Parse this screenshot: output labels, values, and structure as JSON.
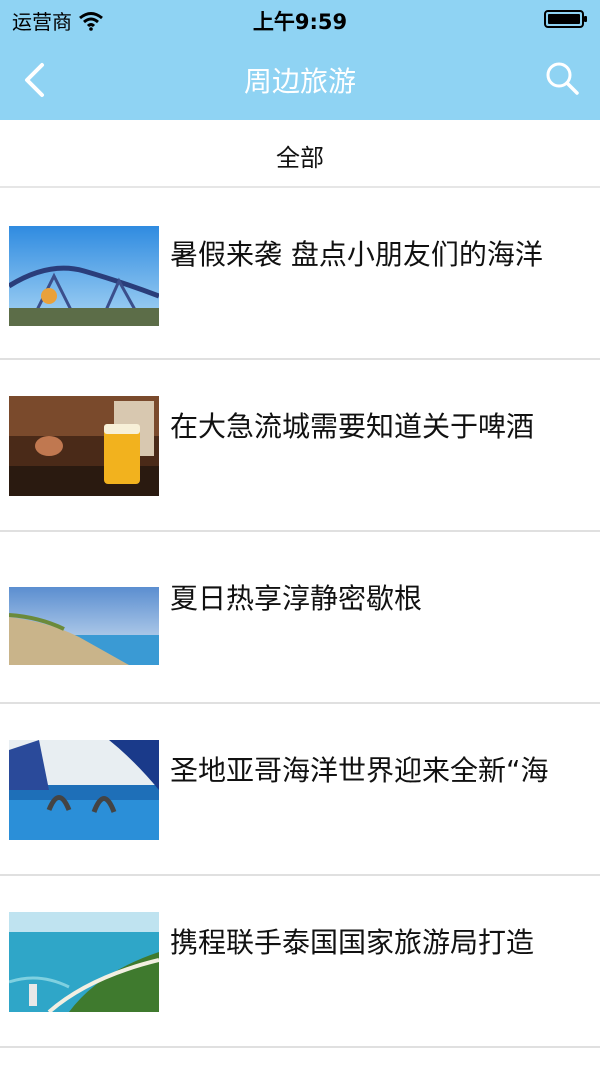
{
  "status": {
    "carrier": "运营商",
    "time": "上午9:59"
  },
  "nav": {
    "title": "周边旅游"
  },
  "filter": {
    "label": "全部"
  },
  "articles": [
    {
      "title": "暑假来袭 盘点小朋友们的海洋"
    },
    {
      "title": "在大急流城需要知道关于啤酒"
    },
    {
      "title": "夏日热享淳静密歇根"
    },
    {
      "title": "圣地亚哥海洋世界迎来全新“海"
    },
    {
      "title": "携程联手泰国国家旅游局打造"
    }
  ],
  "colors": {
    "accent": "#8fd3f3",
    "nav_text": "#ffffff"
  }
}
